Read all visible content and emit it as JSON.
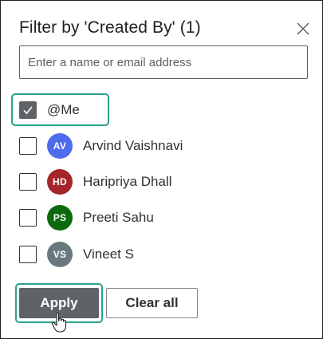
{
  "panel": {
    "title": "Filter by 'Created By' (1)",
    "close_icon": "close-icon"
  },
  "search": {
    "placeholder": "Enter a name or email address",
    "value": ""
  },
  "options": [
    {
      "label": "@Me",
      "checked": true
    },
    {
      "label": "Arvind Vaishnavi",
      "initials": "AV",
      "avatar_color": "#4f6bed",
      "checked": false
    },
    {
      "label": "Haripriya Dhall",
      "initials": "HD",
      "avatar_color": "#a4262c",
      "checked": false
    },
    {
      "label": "Preeti Sahu",
      "initials": "PS",
      "avatar_color": "#0b6a0b",
      "checked": false
    },
    {
      "label": "Vineet S",
      "initials": "VS",
      "avatar_color": "#69797e",
      "checked": false
    }
  ],
  "actions": {
    "apply_label": "Apply",
    "clear_label": "Clear all"
  },
  "colors": {
    "highlight": "#2aa389",
    "checked_fill": "#5f6368",
    "apply_fill": "#5f6368"
  }
}
